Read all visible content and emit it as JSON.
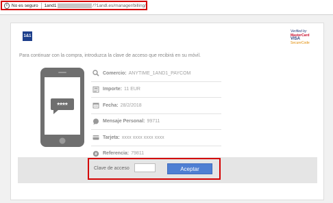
{
  "address_bar": {
    "security_label": "No es seguro",
    "url_prefix": "1and1",
    "url_path": "/?1andl.es/manager/billing/"
  },
  "brand": {
    "logo_text": "1&1",
    "verified_line1": "Verified by",
    "verified_mastercard": "MasterCard",
    "verified_visa": "VISA",
    "verified_securecode": "SecureCode"
  },
  "intro_text": "Para continuar con la compra, introduzca la clave de acceso que recibirá en su móvil.",
  "phone": {
    "pin_mask": "****"
  },
  "details": [
    {
      "icon": "store-icon",
      "label": "Comercio:",
      "value": "ANYTIME_1AND1_PAYCOM"
    },
    {
      "icon": "amount-icon",
      "label": "Importe:",
      "value": "11 EUR"
    },
    {
      "icon": "calendar-icon",
      "label": "Fecha:",
      "value": "28/2/2018"
    },
    {
      "icon": "message-icon",
      "label": "Mensaje Personal:",
      "value": "99711"
    },
    {
      "icon": "card-icon",
      "label": "Tarjeta:",
      "value": "xxxx xxxx xxxx xxxx"
    },
    {
      "icon": "reference-icon",
      "label": "Referencia:",
      "value": "79811"
    }
  ],
  "form": {
    "access_code_label": "Clave de acceso",
    "access_code_value": "",
    "accept_label": "Aceptar"
  },
  "colors": {
    "alert_red": "#d40000",
    "button_blue": "#4f7fd3",
    "brand_blue": "#1c3e8b"
  }
}
